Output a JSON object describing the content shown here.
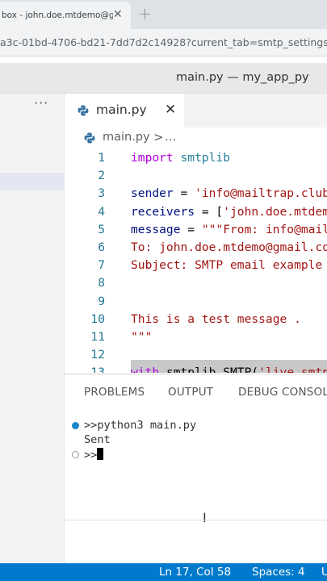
{
  "browser": {
    "tab_title": "box - john.doe.mtdemo@gmail.c",
    "url": "a3c-01bd-4706-bd21-7dd7d2c14928?current_tab=smtp_settings"
  },
  "window": {
    "title": "main.py — my_app_py"
  },
  "sidebar": {
    "more_label": "···"
  },
  "editor": {
    "tab_label": "main.py",
    "breadcrumb_file": "main.py",
    "breadcrumb_sep": ">",
    "breadcrumb_more": "…",
    "lines": [
      {
        "num": "1",
        "parts": [
          {
            "t": "import",
            "c": "kw2"
          },
          {
            "t": " smtplib",
            "c": "fn"
          }
        ]
      },
      {
        "num": "2",
        "parts": []
      },
      {
        "num": "3",
        "parts": [
          {
            "t": "sender",
            "c": "var"
          },
          {
            "t": " = ",
            "c": "plain"
          },
          {
            "t": "'info@mailtrap.club'",
            "c": "str"
          }
        ]
      },
      {
        "num": "4",
        "parts": [
          {
            "t": "receivers",
            "c": "var"
          },
          {
            "t": " = [",
            "c": "plain"
          },
          {
            "t": "'john.doe.mtdemo@gmail.com'",
            "c": "str"
          }
        ]
      },
      {
        "num": "5",
        "parts": [
          {
            "t": "message",
            "c": "var"
          },
          {
            "t": " = ",
            "c": "plain"
          },
          {
            "t": "\"\"\"From: info@mailtrap.club",
            "c": "str"
          }
        ]
      },
      {
        "num": "6",
        "parts": [
          {
            "t": "To: john.doe.mtdemo@gmail.com",
            "c": "str"
          }
        ]
      },
      {
        "num": "7",
        "parts": [
          {
            "t": "Subject: SMTP email example",
            "c": "str"
          }
        ]
      },
      {
        "num": "8",
        "parts": []
      },
      {
        "num": "9",
        "parts": []
      },
      {
        "num": "10",
        "parts": [
          {
            "t": "This is a test message .",
            "c": "str"
          }
        ]
      },
      {
        "num": "11",
        "parts": [
          {
            "t": "\"\"\"",
            "c": "str"
          }
        ]
      },
      {
        "num": "12",
        "parts": []
      },
      {
        "num": "13",
        "parts": [
          {
            "t": "with",
            "c": "kw2"
          },
          {
            "t": " smtplib.SMTP(",
            "c": "plain"
          },
          {
            "t": "'live.smtp",
            "c": "str"
          }
        ]
      }
    ]
  },
  "panel": {
    "tabs": [
      "PROBLEMS",
      "OUTPUT",
      "DEBUG CONSOLE"
    ],
    "terminal": [
      {
        "text": ">>python3 main.py",
        "dot": "filled"
      },
      {
        "text": "Sent",
        "dot": "none"
      },
      {
        "text": ">>",
        "dot": "hollow"
      }
    ]
  },
  "statusbar": {
    "position": "Ln 17, Col 58",
    "spaces": "Spaces: 4",
    "encoding": "U"
  },
  "colors": {
    "status_bar": "#007acc",
    "terminal_dot": "#1a85c8"
  }
}
